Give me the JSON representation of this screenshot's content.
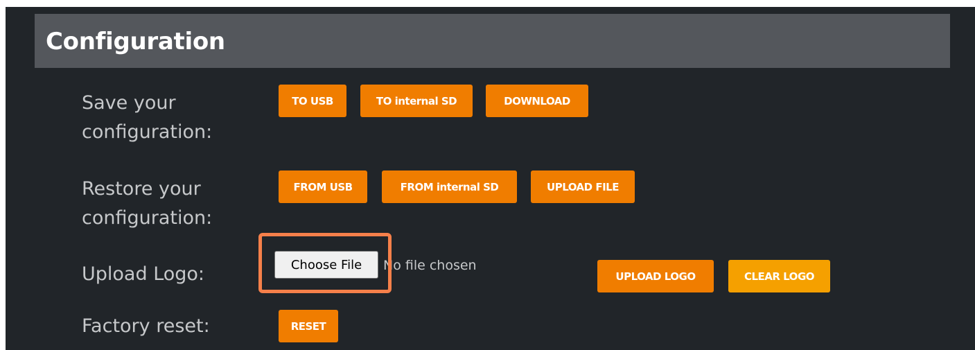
{
  "section": {
    "title": "Configuration"
  },
  "save": {
    "label": "Save your configuration:",
    "buttons": [
      "TO USB",
      "TO internal SD",
      "DOWNLOAD"
    ]
  },
  "restore": {
    "label": "Restore your configuration:",
    "buttons": [
      "FROM USB",
      "FROM internal SD",
      "UPLOAD FILE"
    ]
  },
  "logo": {
    "label": "Upload Logo:",
    "choose_file": "Choose File",
    "file_status": "No file chosen",
    "upload_button": "UPLOAD LOGO",
    "clear_button": "CLEAR LOGO"
  },
  "factory": {
    "label": "Factory reset:",
    "reset_button": "RESET"
  },
  "colors": {
    "background": "#212529",
    "header": "#54575c",
    "button": "#f07d00",
    "highlight": "#f6804a"
  }
}
